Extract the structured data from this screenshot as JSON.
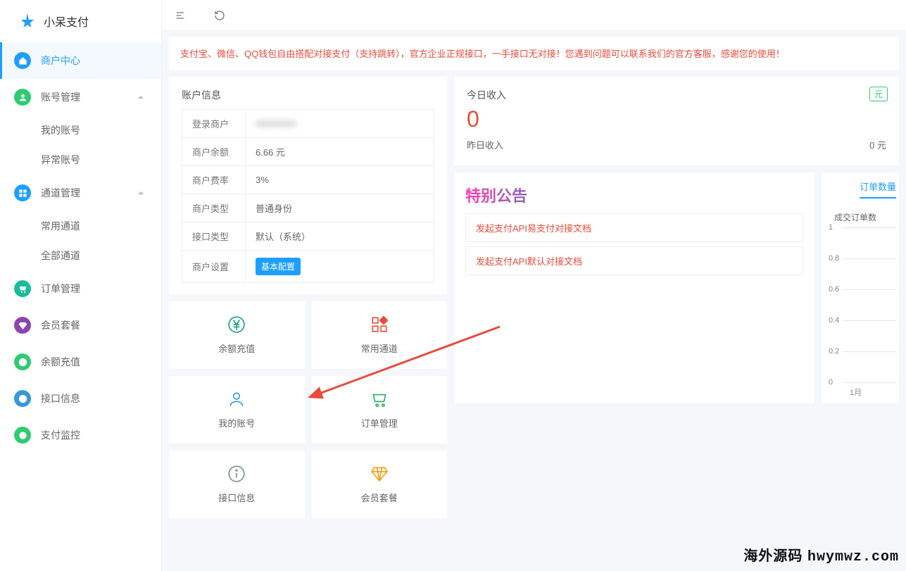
{
  "brand": "小呆支付",
  "sidebar": [
    {
      "label": "商户中心",
      "icon": "home",
      "bg": "bg-blue",
      "active": true
    },
    {
      "label": "账号管理",
      "icon": "user",
      "bg": "bg-green",
      "expand": true,
      "children": [
        "我的账号",
        "异常账号"
      ]
    },
    {
      "label": "通道管理",
      "icon": "grid",
      "bg": "bg-blue",
      "expand": true,
      "children": [
        "常用通道",
        "全部通道"
      ]
    },
    {
      "label": "订单管理",
      "icon": "cart",
      "bg": "bg-teal"
    },
    {
      "label": "会员套餐",
      "icon": "diamond",
      "bg": "bg-purple"
    },
    {
      "label": "余额充值",
      "icon": "yen",
      "bg": "bg-green"
    },
    {
      "label": "接口信息",
      "icon": "info",
      "bg": "bg-info"
    },
    {
      "label": "支付监控",
      "icon": "target",
      "bg": "bg-green"
    }
  ],
  "banner": "支付宝、微信、QQ钱包自由搭配对接支付（支持跳转），官方企业正规接口，一手接口无对接！您遇到问题可以联系我们的官方客服，感谢您的使用！",
  "account": {
    "title": "账户信息",
    "rows": {
      "login": {
        "k": "登录商户",
        "v": ""
      },
      "balance": {
        "k": "商户余额",
        "v": "6.66 元"
      },
      "rate": {
        "k": "商户费率",
        "v": "3%"
      },
      "type": {
        "k": "商户类型",
        "v": "普通身份"
      },
      "api": {
        "k": "接口类型",
        "v": "默认（系统）"
      },
      "setting": {
        "k": "商户设置",
        "v_btn": "基本配置"
      }
    }
  },
  "tiles": [
    {
      "icon": "yen",
      "label": "余额充值",
      "color": "#16a085"
    },
    {
      "icon": "grid4",
      "label": "常用通道",
      "color": "#e74c3c"
    },
    {
      "icon": "user",
      "label": "我的账号",
      "color": "#3498db"
    },
    {
      "icon": "cart",
      "label": "订单管理",
      "color": "#27ae60"
    },
    {
      "icon": "info",
      "label": "接口信息",
      "color": "#7f8c8d"
    },
    {
      "icon": "diamond",
      "label": "会员套餐",
      "color": "#f39c12"
    }
  ],
  "income": {
    "title": "今日收入",
    "currency_badge": "元",
    "today_value": "0",
    "yesterday_label": "昨日收入",
    "yesterday_value": "0 元"
  },
  "notice": {
    "title": "特别公告",
    "items": [
      "发起支付API易支付对接文档",
      "发起支付API默认对接文档"
    ]
  },
  "chart_data": {
    "type": "line",
    "tab": "订单数量",
    "series_name": "成交订单数",
    "categories": [
      "1月"
    ],
    "values": [
      0
    ],
    "ylim": [
      0,
      1
    ],
    "yticks": [
      0,
      0.2,
      0.4,
      0.6,
      0.8,
      1
    ]
  },
  "watermark": {
    "cn": "海外源码",
    "lat": "hwymwz.com"
  }
}
